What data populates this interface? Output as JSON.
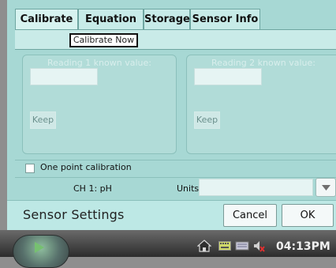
{
  "tabs": [
    {
      "label": "Calibrate",
      "active": true
    },
    {
      "label": "Equation",
      "active": false
    },
    {
      "label": "Storage",
      "active": false
    },
    {
      "label": "Sensor Info",
      "active": false
    }
  ],
  "calibrate_now_label": "Calibrate Now",
  "reading1": {
    "label": "Reading 1 known value:",
    "value": "",
    "keep_label": "Keep"
  },
  "reading2": {
    "label": "Reading 2 known value:",
    "value": "",
    "keep_label": "Keep"
  },
  "one_point": {
    "label": "One point calibration",
    "checked": false
  },
  "channel_label": "CH 1: pH",
  "units": {
    "label": "Units:",
    "value": ""
  },
  "footer": {
    "title": "Sensor Settings",
    "cancel_label": "Cancel",
    "ok_label": "OK"
  },
  "taskbar": {
    "start_icon": "play-icon",
    "tray_icons": [
      "home-icon",
      "keyboard-icon",
      "network-icon",
      "speaker-muted-icon"
    ],
    "clock": "04:13PM"
  },
  "colors": {
    "dialog_bg": "#a7d8d4",
    "taskbar_bg": "#2c2c2c"
  }
}
